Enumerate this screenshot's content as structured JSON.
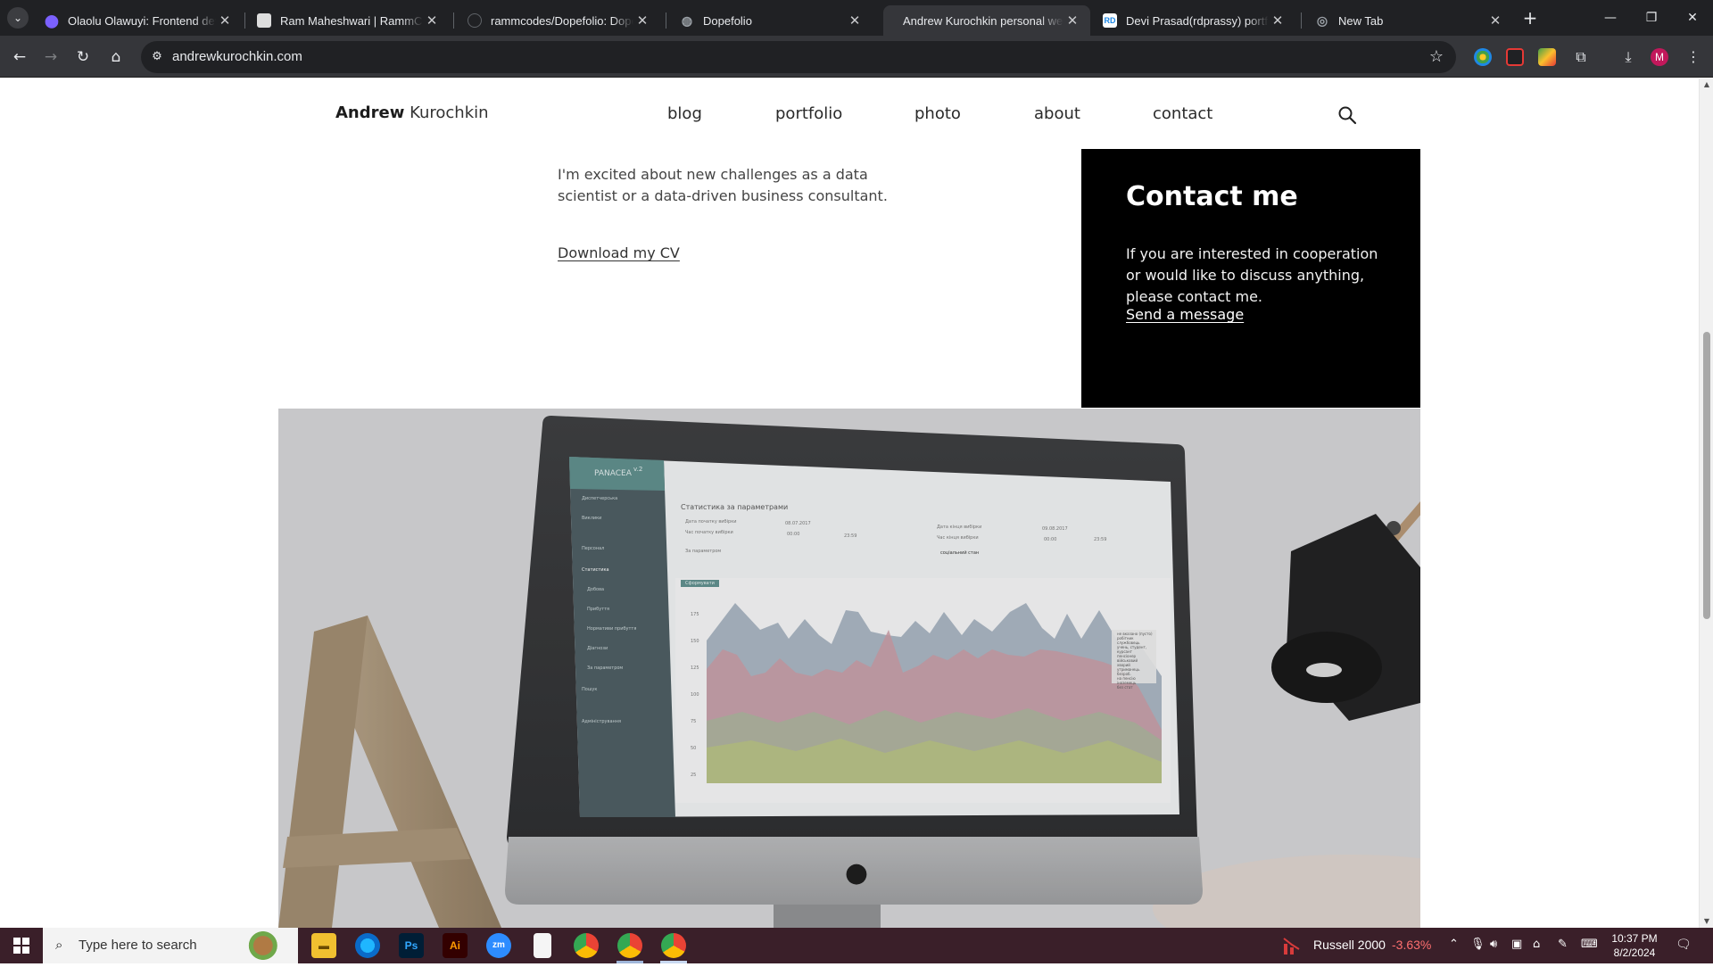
{
  "browser": {
    "tabs": [
      {
        "title": "Olaolu Olawuyi: Frontend deve",
        "favicon": "location-pin-icon",
        "favicon_color": "#7b61ff"
      },
      {
        "title": "Ram Maheshwari | RammCodes",
        "favicon": "person-photo-icon",
        "favicon_color": "#dddddd"
      },
      {
        "title": "rammcodes/Dopefolio: Dopefo",
        "favicon": "github-icon",
        "favicon_color": "#202124"
      },
      {
        "title": "Dopefolio",
        "favicon": "globe-icon",
        "favicon_color": "#9aa0a6"
      },
      {
        "title": "Andrew Kurochkin personal we",
        "favicon": "none",
        "favicon_color": "#35363a",
        "active": true
      },
      {
        "title": "Devi Prasad(rdprassy) portfolio",
        "favicon": "rd-logo-icon",
        "favicon_color": "#1e88e5"
      },
      {
        "title": "New Tab",
        "favicon": "chrome-icon",
        "favicon_color": "#9aa0a6"
      }
    ],
    "url": "andrewkurochkin.com"
  },
  "site": {
    "brand_first": "Andrew",
    "brand_last": "Kurochkin",
    "nav": [
      "blog",
      "portfolio",
      "photo",
      "about",
      "contact"
    ],
    "intro": "I'm excited about new challenges as a data scientist or a data-driven business consultant.",
    "cv_link": "Download my CV",
    "contact": {
      "heading": "Contact me",
      "text": "If you are interested in cooperation or would like to discuss anything, please contact me.",
      "link": "Send a message"
    },
    "screen": {
      "app_name": "PANACEA",
      "app_version": "v.2",
      "page_title": "Статистика за параметрами",
      "filter_labels": [
        "Дата початку вибірки",
        "Час початку вибірки",
        "Дата кінця вибірки",
        "Час кінця вибірки",
        "За параметром"
      ],
      "filter_values": [
        "08.07.2017",
        "00:00",
        "23:59",
        "09.08.2017",
        "00:00",
        "23:59",
        "соціальний стан"
      ],
      "button": "Сформувати",
      "sidebar": [
        "Диспетчерська",
        "Виклики",
        "Персонал",
        "Статистика",
        "Добова",
        "Прибуття",
        "Нормативи прибуття",
        "Діагнози",
        "За параметром",
        "Пошук",
        "Адміністрування"
      ],
      "y_ticks": [
        "175",
        "150",
        "125",
        "100",
        "75",
        "50",
        "25"
      ],
      "legend": [
        "не вказано (пусто)",
        "робітник",
        "службовець",
        "учень, студент, курсант",
        "пенсіонер",
        "військовий",
        "хворий",
        "утриманець",
        "безроб.",
        "на пенсію",
        "іноземець",
        "без стат"
      ]
    }
  },
  "taskbar": {
    "search_placeholder": "Type here to search",
    "apps": [
      "file-explorer-icon",
      "edge-icon",
      "photoshop-icon",
      "illustrator-icon",
      "zoom-icon",
      "notepad-icon",
      "chrome-icon",
      "chrome-profile-icon",
      "chrome-active-icon"
    ],
    "ticker_name": "Russell 2000",
    "ticker_value": "-3.63%",
    "time": "10:37 PM",
    "date": "8/2/2024"
  },
  "colors": {
    "page_bg": "#ffffff",
    "contact_bg": "#000000",
    "chrome_dark": "#202124",
    "taskbar": "#3a1f29",
    "ticker_negative": "#ff6f6f"
  }
}
